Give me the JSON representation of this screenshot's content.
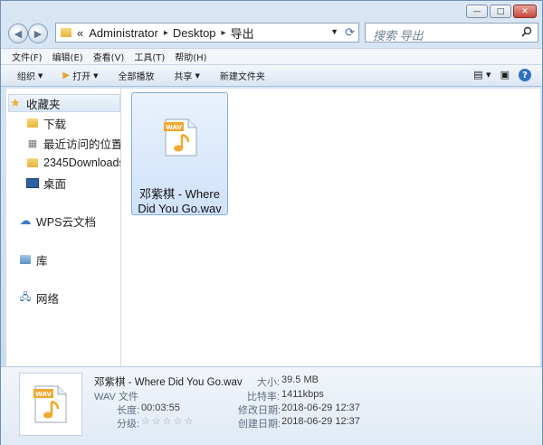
{
  "window": {
    "controls": [
      "—",
      "□",
      "✕"
    ]
  },
  "address": {
    "prefix": "«",
    "segments": [
      "Administrator",
      "Desktop",
      "导出"
    ]
  },
  "search": {
    "placeholder": "搜索 导出"
  },
  "menu": [
    "文件(F)",
    "编辑(E)",
    "查看(V)",
    "工具(T)",
    "帮助(H)"
  ],
  "toolbar": {
    "organize": "组织",
    "open": "打开",
    "play_all": "全部播放",
    "share": "共享",
    "new_folder": "新建文件夹"
  },
  "sidebar": {
    "favorites": "收藏夹",
    "items": [
      "下载",
      "最近访问的位置",
      "2345Downloads",
      "桌面"
    ],
    "wps": "WPS云文档",
    "library": "库",
    "network": "网络"
  },
  "file": {
    "name_line1": "邓紫棋 - Where",
    "name_line2": "Did You Go.wav",
    "badge": "WAV"
  },
  "details": {
    "title": "邓紫棋 - Where Did You Go.wav",
    "type": "WAV 文件",
    "length_label": "长度:",
    "length": "00:03:55",
    "rating_label": "分级:",
    "stars": "☆☆☆☆☆",
    "size_label": "大小:",
    "size": "39.5 MB",
    "bitrate_label": "比特率:",
    "bitrate": "1411kbps",
    "modified_label": "修改日期:",
    "modified": "2018-06-29 12:37",
    "created_label": "创建日期:",
    "created": "2018-06-29 12:37"
  },
  "colors": {
    "selection": "#cfe2fa",
    "wav_icon": "#f0a830"
  }
}
